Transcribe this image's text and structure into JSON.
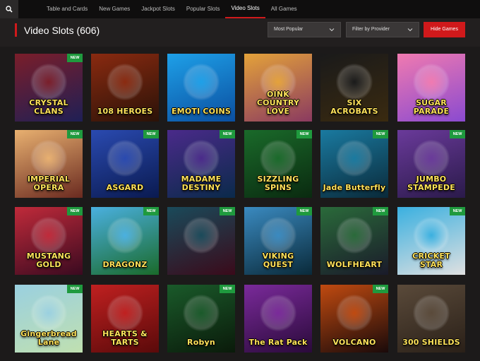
{
  "nav": {
    "items": [
      "Table and Cards",
      "New Games",
      "Jackpot Slots",
      "Popular Slots",
      "Video Slots",
      "All Games"
    ],
    "active_index": 4
  },
  "header": {
    "title": "Video Slots (606)",
    "sort_label": "Most Popular",
    "filter_label": "Filter by Provider",
    "hide_button": "Hide Games"
  },
  "badge_text": "NEW",
  "games": [
    {
      "name": "CRYSTAL CLANS",
      "new": true,
      "bg": [
        "#7a1e2a",
        "#1f1f55"
      ]
    },
    {
      "name": "108 HEROES",
      "new": false,
      "bg": [
        "#8a2a10",
        "#2a1208"
      ]
    },
    {
      "name": "EMOTI COINS",
      "new": false,
      "bg": [
        "#1ea0e8",
        "#0b4fa0"
      ]
    },
    {
      "name": "OINK COUNTRY LOVE",
      "new": false,
      "bg": [
        "#e4a23a",
        "#8a3a60"
      ]
    },
    {
      "name": "SIX ACROBATS",
      "new": false,
      "bg": [
        "#1a1a1a",
        "#3a2a10"
      ]
    },
    {
      "name": "SUGAR PARADE",
      "new": false,
      "bg": [
        "#f07ab0",
        "#8a4ad0"
      ]
    },
    {
      "name": "IMPERIAL OPERA",
      "new": true,
      "bg": [
        "#e8b070",
        "#6a2a20"
      ]
    },
    {
      "name": "ASGARD",
      "new": true,
      "bg": [
        "#2a4ab0",
        "#0a1a50"
      ]
    },
    {
      "name": "MADAME DESTINY",
      "new": true,
      "bg": [
        "#4a2a8a",
        "#0a2a4a"
      ]
    },
    {
      "name": "SIZZLING SPINS",
      "new": true,
      "bg": [
        "#1a6a2a",
        "#0a2a10"
      ]
    },
    {
      "name": "Jade Butterfly",
      "new": true,
      "bg": [
        "#1a7aa0",
        "#0a2a3a"
      ]
    },
    {
      "name": "JUMBO STAMPEDE",
      "new": true,
      "bg": [
        "#6a3a9a",
        "#2a1a4a"
      ]
    },
    {
      "name": "MUSTANG GOLD",
      "new": true,
      "bg": [
        "#c02a3a",
        "#3a0a20"
      ]
    },
    {
      "name": "DRAGONZ",
      "new": true,
      "bg": [
        "#4ab0e0",
        "#1a6a2a"
      ]
    },
    {
      "name": "",
      "new": true,
      "bg": [
        "#1a4a5a",
        "#3a0a1a"
      ]
    },
    {
      "name": "VIKING QUEST",
      "new": true,
      "bg": [
        "#3a8ac0",
        "#0a2a3a"
      ]
    },
    {
      "name": "WOLFHEART",
      "new": true,
      "bg": [
        "#2a6a3a",
        "#1a1a2a"
      ]
    },
    {
      "name": "CRICKET STAR",
      "new": true,
      "bg": [
        "#3ab0e0",
        "#e0e0e0"
      ]
    },
    {
      "name": "Gingerbread Lane",
      "new": true,
      "bg": [
        "#9ad0e0",
        "#c0e0b0"
      ]
    },
    {
      "name": "HEARTS & TARTS",
      "new": false,
      "bg": [
        "#c02020",
        "#5a0a0a"
      ]
    },
    {
      "name": "Robyn",
      "new": true,
      "bg": [
        "#1a5a2a",
        "#0a1a0a"
      ]
    },
    {
      "name": "The Rat Pack",
      "new": false,
      "bg": [
        "#7a2a9a",
        "#2a0a3a"
      ]
    },
    {
      "name": "VOLCANO",
      "new": true,
      "bg": [
        "#c04a10",
        "#1a0a0a"
      ]
    },
    {
      "name": "300 SHIELDS",
      "new": false,
      "bg": [
        "#5a4a3a",
        "#2a2018"
      ]
    }
  ]
}
